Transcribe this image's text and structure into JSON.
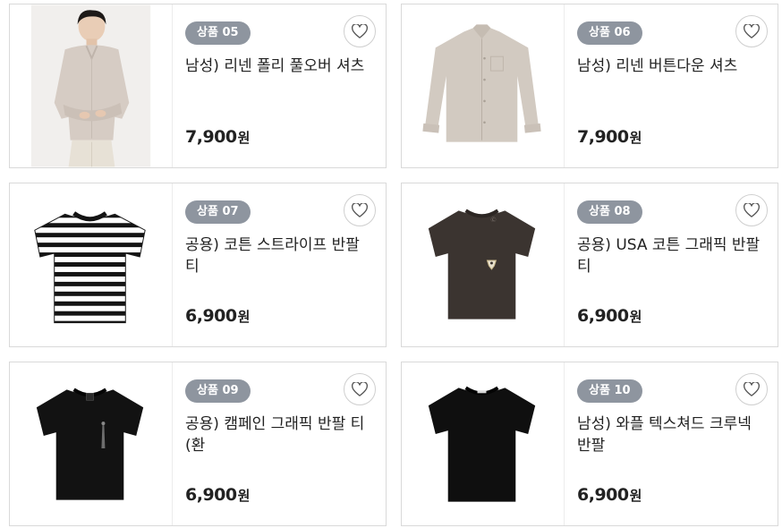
{
  "products": [
    {
      "badge": "상품 05",
      "title": "남성) 리넨 폴리 풀오버 셔츠",
      "price": "7,900",
      "currency": "원",
      "image": "model-linen-shirt",
      "color": "#d6ccc4"
    },
    {
      "badge": "상품 06",
      "title": "남성) 리넨 버튼다운 셔츠",
      "price": "7,900",
      "currency": "원",
      "image": "linen-shirt",
      "color": "#d2cac1"
    },
    {
      "badge": "상품 07",
      "title": "공용) 코튼 스트라이프 반팔 티",
      "price": "6,900",
      "currency": "원",
      "image": "stripe-tshirt",
      "color": "#111111"
    },
    {
      "badge": "상품 08",
      "title": "공용) USA 코튼 그래픽 반팔 티",
      "price": "6,900",
      "currency": "원",
      "image": "brown-graphic-tshirt",
      "color": "#3b3430"
    },
    {
      "badge": "상품 09",
      "title": "공용) 캠페인 그래픽 반팔 티 (환",
      "price": "6,900",
      "currency": "원",
      "image": "black-campaign-tshirt",
      "color": "#111111"
    },
    {
      "badge": "상품 10",
      "title": "남성) 와플 텍스쳐드 크루넥 반팔",
      "price": "6,900",
      "currency": "원",
      "image": "black-waffle-tshirt",
      "color": "#0f0f0f"
    }
  ]
}
